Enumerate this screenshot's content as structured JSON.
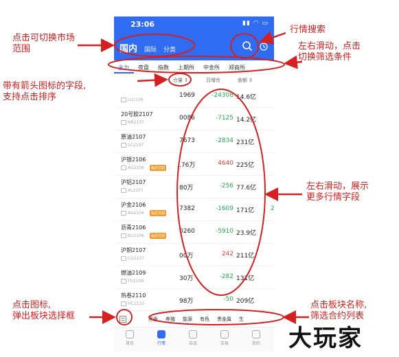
{
  "status": {
    "time": "23:06",
    "icons": "▮▮ ◠ ▭"
  },
  "market_tabs": [
    {
      "label": "国内",
      "active": true
    },
    {
      "label": "国际",
      "active": false
    },
    {
      "label": "分类",
      "active": false
    }
  ],
  "filter_tabs": [
    {
      "label": "主力",
      "active": true
    },
    {
      "label": "夜盘",
      "active": false
    },
    {
      "label": "指数",
      "active": false
    },
    {
      "label": "上期所",
      "active": false
    },
    {
      "label": "中金所",
      "active": false
    },
    {
      "label": "郑商所",
      "active": false
    }
  ],
  "columns": {
    "position": "仓量 ↕",
    "daily_change": "日增仓",
    "amount": "金额 ↕"
  },
  "rows": [
    {
      "name": "",
      "code": "LU2106",
      "tag": "",
      "position": "1969",
      "change": "-24308",
      "amount": "14.6亿",
      "dir": "down",
      "ext": ""
    },
    {
      "name": "20号胶2107",
      "code": "NR2107",
      "tag": "",
      "position": "0086",
      "change": "-7125",
      "amount": "14.2亿",
      "dir": "down",
      "ext": ""
    },
    {
      "name": "原油2107",
      "code": "SC2107",
      "tag": "",
      "position": "7673",
      "change": "-2834",
      "amount": "231亿",
      "dir": "down",
      "ext": ""
    },
    {
      "name": "沪银2106",
      "code": "AG2106",
      "tag": "临近交割",
      "position": ".76万",
      "change": "4640",
      "amount": "225亿",
      "dir": "up",
      "ext": ""
    },
    {
      "name": "沪铝2107",
      "code": "AL2107",
      "tag": "",
      "position": "80万",
      "change": "-256",
      "amount": "77.6亿",
      "dir": "down",
      "ext": ""
    },
    {
      "name": "沪金2106",
      "code": "AU2106",
      "tag": "临近交割",
      "position": "7382",
      "change": "-1609",
      "amount": "171亿",
      "dir": "down",
      "ext": "2"
    },
    {
      "name": "沥青2106",
      "code": "BU2106",
      "tag": "临近交割",
      "position": "0260",
      "change": "-5910",
      "amount": "23.9亿",
      "dir": "down",
      "ext": ""
    },
    {
      "name": "沪铜2107",
      "code": "CU2107",
      "tag": "",
      "position": "00万",
      "change": "242",
      "amount": "211亿",
      "dir": "up",
      "ext": ""
    },
    {
      "name": "燃油2109",
      "code": "FU2109",
      "tag": "",
      "position": "30万",
      "change": "-282",
      "amount": "131亿",
      "dir": "down",
      "ext": ""
    },
    {
      "name": "热卷2110",
      "code": "HC2110",
      "tag": "",
      "position": "98万",
      "change": "-50",
      "amount": "209亿",
      "dir": "down",
      "ext": ""
    }
  ],
  "sectors": [
    "黑色",
    "养殖",
    "能源",
    "有色",
    "贵金属",
    "生"
  ],
  "nav": [
    {
      "label": "首页",
      "active": false
    },
    {
      "label": "行情",
      "active": true
    },
    {
      "label": "自选",
      "active": false
    },
    {
      "label": "交易",
      "active": false
    },
    {
      "label": "我的",
      "active": false
    }
  ],
  "annotations": {
    "switch_market": "点击可切换市场\n范围",
    "search": "行情搜索",
    "swipe_filter": "左右滑动，点击\n切换筛选条件",
    "sortable": "带有箭头图标的字段,\n支持点击排序",
    "swipe_fields": "左右滑动，展示\n更多行情字段",
    "click_icon": "点击图标,\n弹出板块选择框",
    "click_sector": "点击板块名称,\n筛选合约列表"
  },
  "watermark": "大玩家",
  "colors": {
    "brand_blue": "#2f6cf2",
    "annotation_red": "#d42020",
    "up_red": "#e03c3c",
    "down_green": "#24a852",
    "tag_orange": "#f39a2c"
  }
}
